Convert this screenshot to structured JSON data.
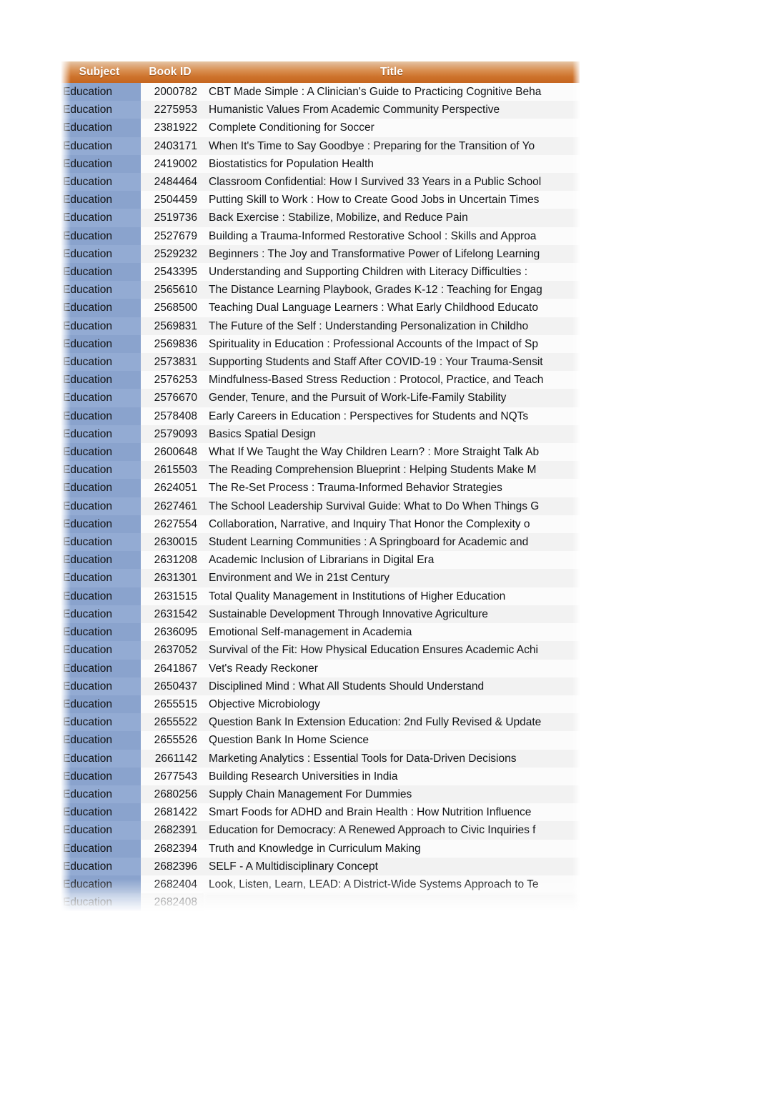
{
  "table": {
    "columns": [
      {
        "key": "subject",
        "label": "Subject",
        "align": "left"
      },
      {
        "key": "book_id",
        "label": "Book ID",
        "align": "right"
      },
      {
        "key": "title",
        "label": "Title",
        "align": "left"
      }
    ],
    "header_gradient": {
      "top": "#e7c8a7",
      "bottom": "#c5651f"
    },
    "subject_cell_color": "#8ba4ce",
    "data_cell_color": "#fafafa",
    "text_color": "#111316",
    "header_text_color": "#ffffff",
    "row_count": 46,
    "rows": [
      {
        "subject": "Education",
        "book_id": "2000782",
        "title": "CBT Made Simple : A Clinician's Guide to Practicing Cognitive Beha"
      },
      {
        "subject": "Education",
        "book_id": "2275953",
        "title": "Humanistic Values From Academic Community Perspective"
      },
      {
        "subject": "Education",
        "book_id": "2381922",
        "title": "Complete Conditioning for Soccer"
      },
      {
        "subject": "Education",
        "book_id": "2403171",
        "title": "When It's Time to Say Goodbye : Preparing for the Transition of Yo"
      },
      {
        "subject": "Education",
        "book_id": "2419002",
        "title": "Biostatistics for Population Health"
      },
      {
        "subject": "Education",
        "book_id": "2484464",
        "title": "Classroom Confidential: How I Survived 33 Years in a Public School"
      },
      {
        "subject": "Education",
        "book_id": "2504459",
        "title": "Putting Skill to Work : How to Create Good Jobs in Uncertain Times"
      },
      {
        "subject": "Education",
        "book_id": "2519736",
        "title": "Back Exercise : Stabilize, Mobilize, and Reduce Pain"
      },
      {
        "subject": "Education",
        "book_id": "2527679",
        "title": "Building a Trauma-Informed Restorative School : Skills and Approa"
      },
      {
        "subject": "Education",
        "book_id": "2529232",
        "title": "Beginners : The Joy and Transformative Power of Lifelong Learning"
      },
      {
        "subject": "Education",
        "book_id": "2543395",
        "title": "Understanding and Supporting Children with Literacy Difficulties :"
      },
      {
        "subject": "Education",
        "book_id": "2565610",
        "title": "The Distance Learning Playbook, Grades K-12 : Teaching for Engag"
      },
      {
        "subject": "Education",
        "book_id": "2568500",
        "title": "Teaching Dual Language Learners : What Early Childhood Educato"
      },
      {
        "subject": "Education",
        "book_id": "2569831",
        "title": "The Future of the Self : Understanding Personalization in Childho"
      },
      {
        "subject": "Education",
        "book_id": "2569836",
        "title": "Spirituality in Education : Professional Accounts of the Impact of Sp"
      },
      {
        "subject": "Education",
        "book_id": "2573831",
        "title": "Supporting Students and Staff After COVID-19 : Your Trauma-Sensit"
      },
      {
        "subject": "Education",
        "book_id": "2576253",
        "title": "Mindfulness-Based Stress Reduction : Protocol, Practice, and Teach"
      },
      {
        "subject": "Education",
        "book_id": "2576670",
        "title": "Gender, Tenure, and the Pursuit of Work-Life-Family Stability"
      },
      {
        "subject": "Education",
        "book_id": "2578408",
        "title": "Early Careers in Education : Perspectives for Students and NQTs"
      },
      {
        "subject": "Education",
        "book_id": "2579093",
        "title": "Basics Spatial Design"
      },
      {
        "subject": "Education",
        "book_id": "2600648",
        "title": "What If We Taught the Way Children Learn? : More Straight Talk Ab"
      },
      {
        "subject": "Education",
        "book_id": "2615503",
        "title": "The Reading Comprehension Blueprint : Helping Students Make M"
      },
      {
        "subject": "Education",
        "book_id": "2624051",
        "title": "The Re-Set Process : Trauma-Informed Behavior Strategies"
      },
      {
        "subject": "Education",
        "book_id": "2627461",
        "title": "The School Leadership Survival Guide: What to Do When Things G"
      },
      {
        "subject": "Education",
        "book_id": "2627554",
        "title": "Collaboration, Narrative, and Inquiry That Honor the Complexity o"
      },
      {
        "subject": "Education",
        "book_id": "2630015",
        "title": "Student Learning Communities : A Springboard for Academic and"
      },
      {
        "subject": "Education",
        "book_id": "2631208",
        "title": "Academic Inclusion of Librarians in Digital Era"
      },
      {
        "subject": "Education",
        "book_id": "2631301",
        "title": "Environment and We in 21st Century"
      },
      {
        "subject": "Education",
        "book_id": "2631515",
        "title": "Total Quality Management in Institutions of Higher Education"
      },
      {
        "subject": "Education",
        "book_id": "2631542",
        "title": "Sustainable Development Through Innovative Agriculture"
      },
      {
        "subject": "Education",
        "book_id": "2636095",
        "title": "Emotional Self-management in Academia"
      },
      {
        "subject": "Education",
        "book_id": "2637052",
        "title": "Survival of the Fit: How Physical Education Ensures Academic Achi"
      },
      {
        "subject": "Education",
        "book_id": "2641867",
        "title": "Vet's Ready Reckoner"
      },
      {
        "subject": "Education",
        "book_id": "2650437",
        "title": "Disciplined Mind : What All Students Should Understand"
      },
      {
        "subject": "Education",
        "book_id": "2655515",
        "title": "Objective Microbiology"
      },
      {
        "subject": "Education",
        "book_id": "2655522",
        "title": "Question Bank In Extension Education: 2nd Fully Revised & Update"
      },
      {
        "subject": "Education",
        "book_id": "2655526",
        "title": "Question Bank In Home Science"
      },
      {
        "subject": "Education",
        "book_id": "2661142",
        "title": "Marketing Analytics : Essential Tools for Data-Driven Decisions"
      },
      {
        "subject": "Education",
        "book_id": "2677543",
        "title": "Building Research Universities in India"
      },
      {
        "subject": "Education",
        "book_id": "2680256",
        "title": "Supply Chain Management For Dummies"
      },
      {
        "subject": "Education",
        "book_id": "2681422",
        "title": "Smart Foods for ADHD and Brain Health : How Nutrition Influence"
      },
      {
        "subject": "Education",
        "book_id": "2682391",
        "title": "Education for Democracy: A Renewed Approach to Civic Inquiries f"
      },
      {
        "subject": "Education",
        "book_id": "2682394",
        "title": "Truth and Knowledge in Curriculum Making"
      },
      {
        "subject": "Education",
        "book_id": "2682396",
        "title": "SELF - A Multidisciplinary Concept"
      },
      {
        "subject": "Education",
        "book_id": "2682404",
        "title": "Look, Listen, Learn, LEAD: A District-Wide Systems Approach to Te"
      },
      {
        "subject": "Education",
        "book_id": "2682408",
        "title": "",
        "faded": true
      }
    ]
  }
}
